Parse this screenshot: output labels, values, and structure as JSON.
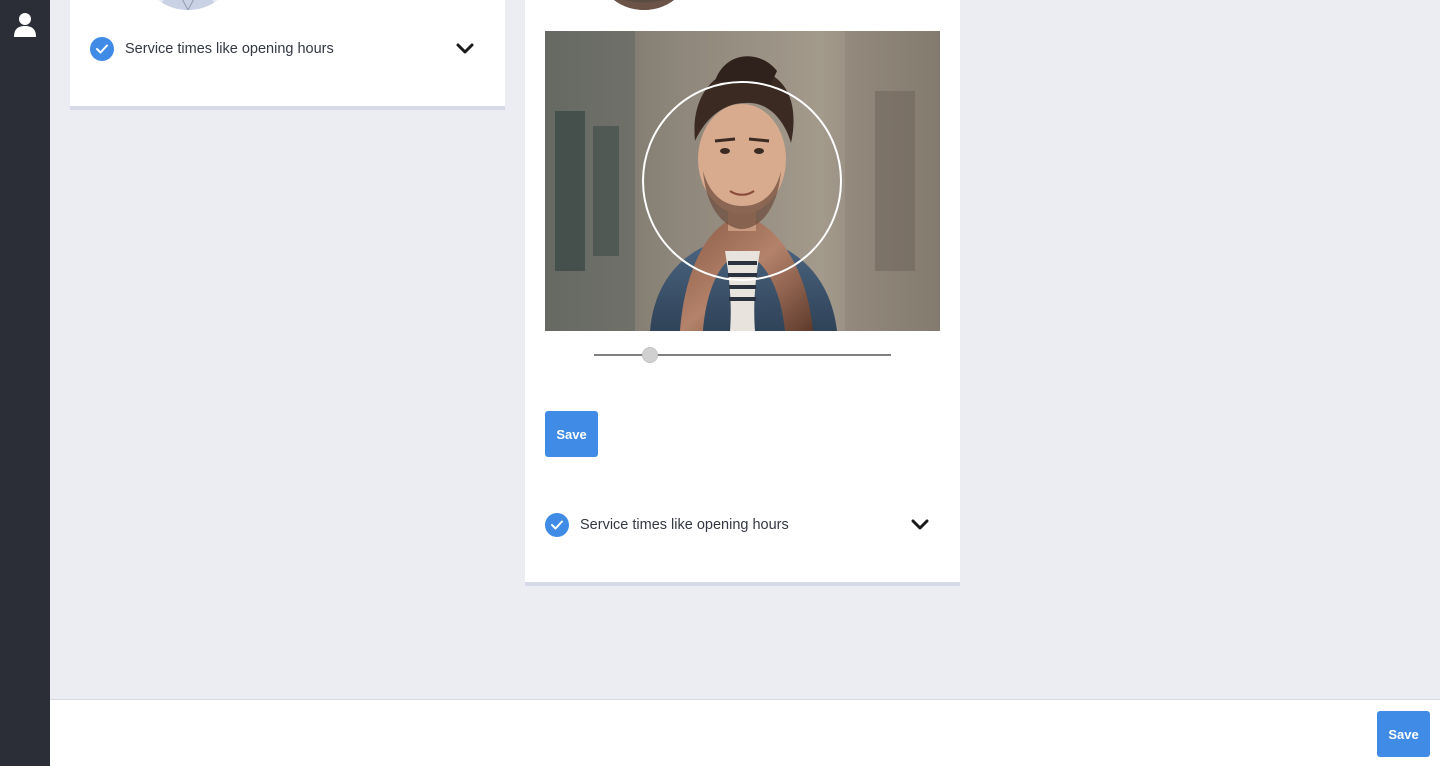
{
  "sidebar": {
    "icons": [
      "user-icon"
    ]
  },
  "cards": [
    {
      "service_label": "Service times like opening hours",
      "checked": true
    },
    {
      "service_label": "Service times like opening hours",
      "checked": true,
      "zoom_slider": {
        "value": 0.19
      },
      "save_label": "Save"
    }
  ],
  "footer": {
    "save_label": "Save"
  },
  "colors": {
    "accent": "#3f8be6",
    "sidebar": "#2b2e36",
    "background": "#ecedf3"
  }
}
